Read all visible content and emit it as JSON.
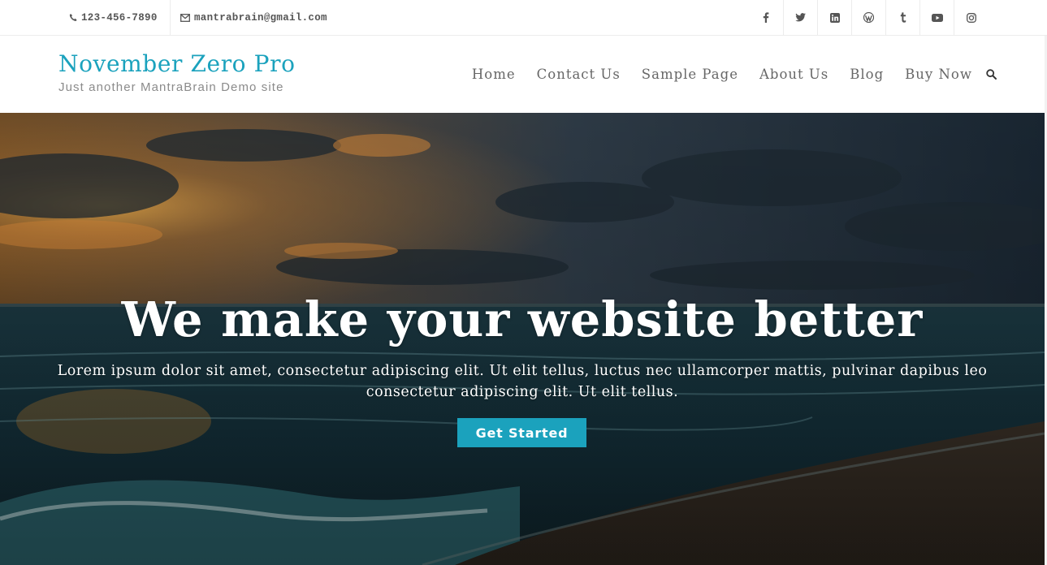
{
  "topbar": {
    "phone": "123-456-7890",
    "email": "mantrabrain@gmail.com",
    "social": [
      {
        "icon": "facebook-icon"
      },
      {
        "icon": "twitter-icon"
      },
      {
        "icon": "linkedin-icon"
      },
      {
        "icon": "wordpress-icon"
      },
      {
        "icon": "tumblr-icon"
      },
      {
        "icon": "youtube-icon"
      },
      {
        "icon": "instagram-icon"
      }
    ]
  },
  "header": {
    "site_title": "November Zero Pro",
    "tagline": "Just another MantraBrain Demo site",
    "nav": [
      "Home",
      "Contact Us",
      "Sample Page",
      "About Us",
      "Blog",
      "Buy Now"
    ],
    "search_icon": "search-icon"
  },
  "hero": {
    "title": "We make your website better",
    "text": "Lorem ipsum dolor sit amet, consectetur adipiscing elit. Ut elit tellus, luctus nec ullamcorper mattis, pulvinar dapibus leo consectetur adipiscing elit. Ut elit tellus.",
    "button": "Get Started"
  },
  "colors": {
    "accent": "#1ba2bd",
    "nav_text": "#666666",
    "topbar_text": "#555555"
  }
}
